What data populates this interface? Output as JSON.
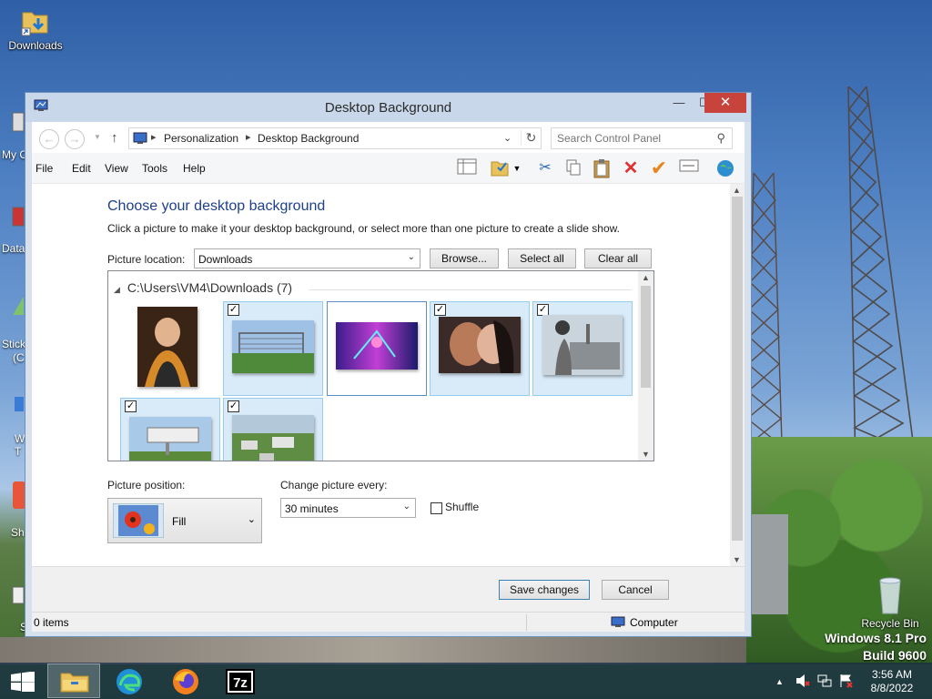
{
  "desktop": {
    "icons": [
      {
        "label": "Downloads"
      },
      {
        "label": "Recycle Bin"
      }
    ],
    "edge_labels": [
      "My C",
      "Data",
      "Stick",
      "(C",
      "W",
      "T",
      "Sh",
      "S"
    ],
    "watermark": {
      "line1": "Windows 8.1 Pro",
      "line2": "Build 9600"
    }
  },
  "window": {
    "title": "Desktop Background",
    "controls": {
      "minimize": "—",
      "maximize": "☐",
      "close": "✕"
    },
    "address": {
      "crumbs": [
        "Personalization",
        "Desktop Background"
      ],
      "search_placeholder": "Search Control Panel"
    },
    "menu": [
      "File",
      "Edit",
      "View",
      "Tools",
      "Help"
    ],
    "toolbar_icons": [
      "layout-icon",
      "properties-icon",
      "cut-icon",
      "copy-icon",
      "paste-icon",
      "delete-icon",
      "check-icon",
      "rename-icon",
      "globe-icon"
    ]
  },
  "page": {
    "heading": "Choose your desktop background",
    "subtext": "Click a picture to make it your desktop background, or select more than one picture to create a slide show.",
    "location_label": "Picture location:",
    "location_value": "Downloads",
    "browse_label": "Browse...",
    "select_all_label": "Select all",
    "clear_all_label": "Clear all",
    "gallery": {
      "group_title": "C:\\Users\\VM4\\Downloads (7)",
      "items": [
        {
          "name": "portrait",
          "checked": false,
          "selected": false
        },
        {
          "name": "antenna-field",
          "checked": true,
          "selected": true
        },
        {
          "name": "neon-figure",
          "checked": false,
          "selected": false
        },
        {
          "name": "couple-kiss",
          "checked": true,
          "selected": true
        },
        {
          "name": "power-plant",
          "checked": true,
          "selected": true
        },
        {
          "name": "town-sign",
          "checked": true,
          "selected": true
        },
        {
          "name": "city-aerial",
          "checked": true,
          "selected": true
        }
      ]
    },
    "position_label": "Picture position:",
    "position_value": "Fill",
    "interval_label": "Change picture every:",
    "interval_value": "30 minutes",
    "shuffle_label": "Shuffle",
    "shuffle_checked": false,
    "save_label": "Save changes",
    "cancel_label": "Cancel"
  },
  "statusbar": {
    "items_text": "0 items",
    "location_text": "Computer"
  },
  "taskbar": {
    "apps": [
      "file-explorer",
      "edge",
      "firefox",
      "7zip"
    ],
    "active_app": "file-explorer",
    "time": "3:56 AM",
    "date": "8/8/2022"
  },
  "colors": {
    "heading": "#1e3f8c",
    "close_button": "#c7433b",
    "selected_thumb": "#d9ebf9"
  }
}
